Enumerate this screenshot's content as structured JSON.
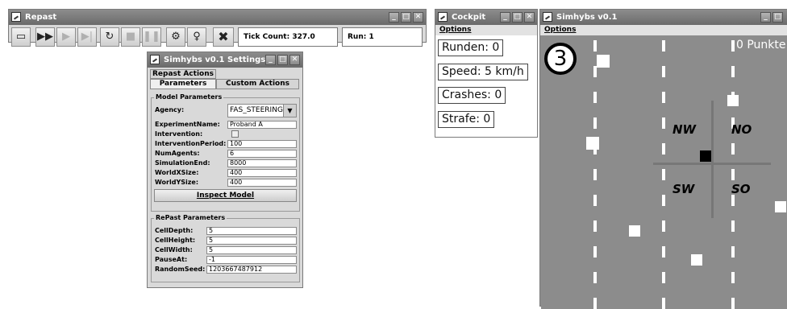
{
  "repast": {
    "title": "Repast",
    "tick_count": "Tick Count: 327.0",
    "run": "Run: 1"
  },
  "settings": {
    "title": "Simhybs v0.1 Settings",
    "tabs": [
      "Repast Actions",
      "Parameters",
      "Custom Actions"
    ],
    "model_group": "Model Parameters",
    "model_params": [
      {
        "label": "Agency:",
        "value": "FAS_STEERING"
      },
      {
        "label": "ExperimentName:",
        "value": "Proband A"
      },
      {
        "label": "Intervention:",
        "value": ""
      },
      {
        "label": "InterventionPeriod:",
        "value": "100"
      },
      {
        "label": "NumAgents:",
        "value": "6"
      },
      {
        "label": "SimulationEnd:",
        "value": "8000"
      },
      {
        "label": "WorldXSize:",
        "value": "400"
      },
      {
        "label": "WorldYSize:",
        "value": "400"
      }
    ],
    "inspect_model": "Inspect Model",
    "repast_group": "RePast Parameters",
    "repast_params": [
      {
        "label": "CellDepth:",
        "value": "5"
      },
      {
        "label": "CellHeight:",
        "value": "5"
      },
      {
        "label": "CellWidth:",
        "value": "5"
      },
      {
        "label": "PauseAt:",
        "value": "-1"
      },
      {
        "label": "RandomSeed:",
        "value": "1203667487912"
      }
    ]
  },
  "cockpit": {
    "title": "Cockpit",
    "menu": "Options",
    "runden": "Runden: 0",
    "speed": "Speed: 5 km/h",
    "crashes": "Crashes: 0",
    "strafe": "Strafe: 0"
  },
  "simhybs": {
    "title": "Simhybs v0.1",
    "menu": "Options",
    "score": "0 Punkte",
    "countdown": "3",
    "directions": [
      "NW",
      "NO",
      "SW",
      "SO"
    ]
  },
  "colors": {
    "titlebar": "#6f6f6f",
    "window_bg": "#d9d9d9",
    "road": "#8c8c8c"
  }
}
